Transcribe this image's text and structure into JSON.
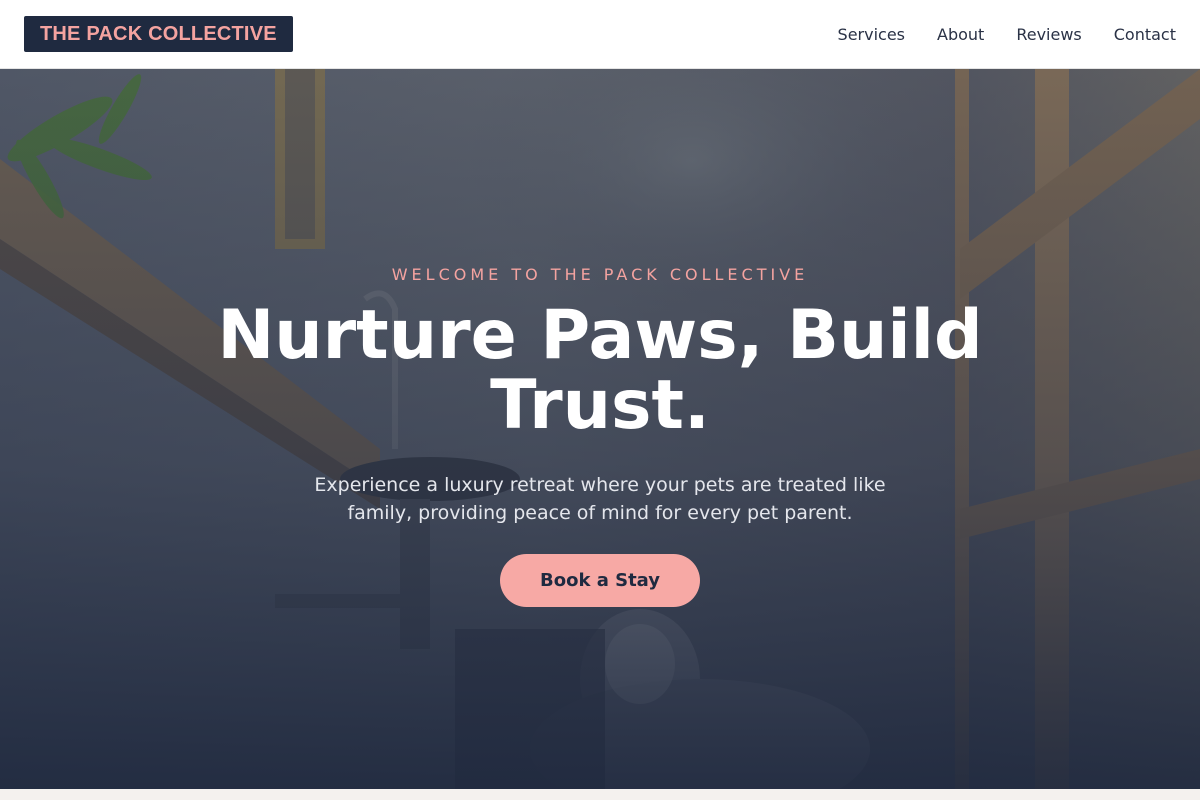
{
  "brand": {
    "name": "THE PACK COLLECTIVE"
  },
  "nav": {
    "items": [
      {
        "label": "Services"
      },
      {
        "label": "About"
      },
      {
        "label": "Reviews"
      },
      {
        "label": "Contact"
      }
    ]
  },
  "hero": {
    "eyebrow": "WELCOME TO THE PACK COLLECTIVE",
    "headline": "Nurture Paws, Build Trust.",
    "subtext": "Experience a luxury retreat where your pets are treated like family, providing peace of mind for every pet parent.",
    "cta_label": "Book a Stay",
    "background_image": "dog-in-grooming-room-photo"
  },
  "colors": {
    "brand_navy": "#1f2a40",
    "accent_pink": "#f4a3a0",
    "button_pink": "#f7a9a5"
  }
}
